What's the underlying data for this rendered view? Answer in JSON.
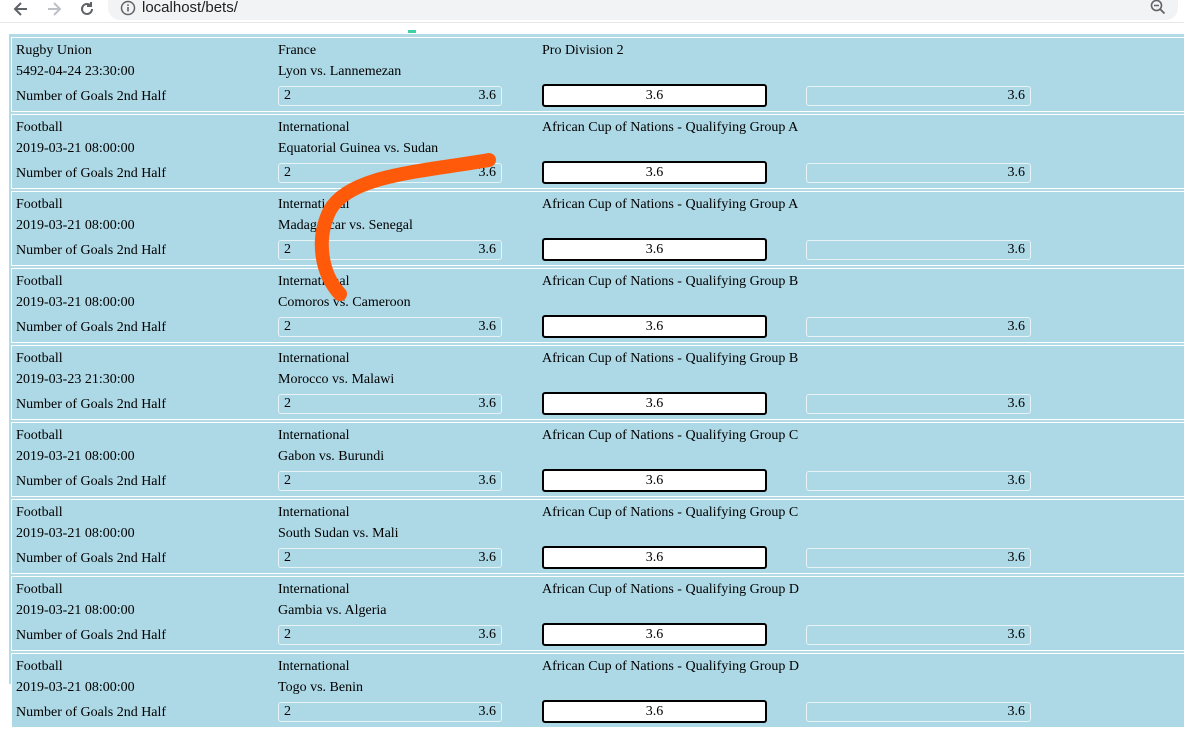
{
  "browser": {
    "url": "localhost/bets/"
  },
  "bets": [
    {
      "sport": "Rugby Union",
      "date": "5492-04-24 23:30:00",
      "country": "France",
      "match": "Lyon vs. Lannemezan",
      "league": "Pro Division 2",
      "market": "Number of Goals 2nd Half",
      "line": "2",
      "odd1": "3.6",
      "odd2": "3.6",
      "odd3": "3.6"
    },
    {
      "sport": "Football",
      "date": "2019-03-21 08:00:00",
      "country": "International",
      "match": "Equatorial Guinea vs. Sudan",
      "league": "African Cup of Nations - Qualifying Group A",
      "market": "Number of Goals 2nd Half",
      "line": "2",
      "odd1": "3.6",
      "odd2": "3.6",
      "odd3": "3.6"
    },
    {
      "sport": "Football",
      "date": "2019-03-21 08:00:00",
      "country": "International",
      "match": "Madagascar vs. Senegal",
      "league": "African Cup of Nations - Qualifying Group A",
      "market": "Number of Goals 2nd Half",
      "line": "2",
      "odd1": "3.6",
      "odd2": "3.6",
      "odd3": "3.6"
    },
    {
      "sport": "Football",
      "date": "2019-03-21 08:00:00",
      "country": "International",
      "match": "Comoros vs. Cameroon",
      "league": "African Cup of Nations - Qualifying Group B",
      "market": "Number of Goals 2nd Half",
      "line": "2",
      "odd1": "3.6",
      "odd2": "3.6",
      "odd3": "3.6"
    },
    {
      "sport": "Football",
      "date": "2019-03-23 21:30:00",
      "country": "International",
      "match": "Morocco vs. Malawi",
      "league": "African Cup of Nations - Qualifying Group B",
      "market": "Number of Goals 2nd Half",
      "line": "2",
      "odd1": "3.6",
      "odd2": "3.6",
      "odd3": "3.6"
    },
    {
      "sport": "Football",
      "date": "2019-03-21 08:00:00",
      "country": "International",
      "match": "Gabon vs. Burundi",
      "league": "African Cup of Nations - Qualifying Group C",
      "market": "Number of Goals 2nd Half",
      "line": "2",
      "odd1": "3.6",
      "odd2": "3.6",
      "odd3": "3.6"
    },
    {
      "sport": "Football",
      "date": "2019-03-21 08:00:00",
      "country": "International",
      "match": "South Sudan vs. Mali",
      "league": "African Cup of Nations - Qualifying Group C",
      "market": "Number of Goals 2nd Half",
      "line": "2",
      "odd1": "3.6",
      "odd2": "3.6",
      "odd3": "3.6"
    },
    {
      "sport": "Football",
      "date": "2019-03-21 08:00:00",
      "country": "International",
      "match": "Gambia vs. Algeria",
      "league": "African Cup of Nations - Qualifying Group D",
      "market": "Number of Goals 2nd Half",
      "line": "2",
      "odd1": "3.6",
      "odd2": "3.6",
      "odd3": "3.6"
    },
    {
      "sport": "Football",
      "date": "2019-03-21 08:00:00",
      "country": "International",
      "match": "Togo vs. Benin",
      "league": "African Cup of Nations - Qualifying Group D",
      "market": "Number of Goals 2nd Half",
      "line": "2",
      "odd1": "3.6",
      "odd2": "3.6",
      "odd3": "3.6"
    }
  ],
  "colors": {
    "row_background": "#add8e6",
    "annotation_stroke": "#ff5a0a"
  }
}
